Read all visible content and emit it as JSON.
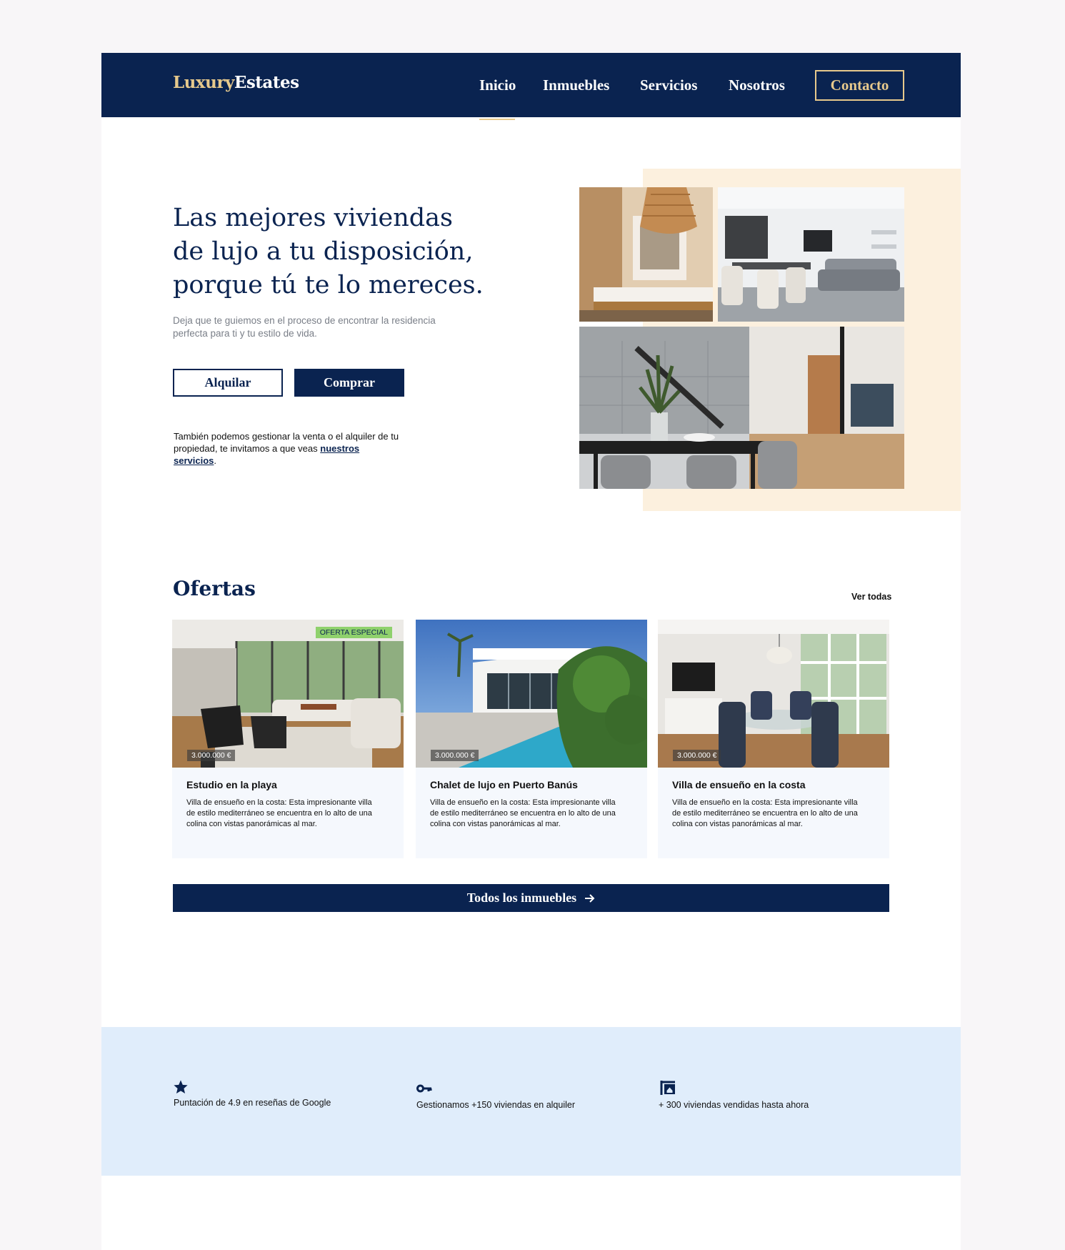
{
  "brand": {
    "part1": "Luxury",
    "part2": "Estates"
  },
  "nav": {
    "items": [
      "Inicio",
      "Inmuebles",
      "Servicios",
      "Nosotros"
    ],
    "contact": "Contacto"
  },
  "hero": {
    "title": "Las mejores viviendas de lujo a tu disposición, porque tú te lo mereces.",
    "subtitle": "Deja que te guiemos en el proceso de encontrar la residencia perfecta para ti y tu estilo de vida.",
    "rent_label": "Alquilar",
    "buy_label": "Comprar",
    "note_text": "También podemos gestionar la venta o el alquiler de tu propiedad, te invitamos a que veas ",
    "note_link": "nuestros servicios",
    "note_end": "."
  },
  "offers": {
    "title": "Ofertas",
    "see_all": "Ver todas",
    "cards": [
      {
        "title": "Estudio en la playa",
        "price": "3.000.000 €",
        "badge": "OFERTA ESPECIAL",
        "desc": "Villa de ensueño en la costa: Esta impresionante villa de estilo mediterráneo se encuentra en lo alto de una colina con vistas panorámicas al mar."
      },
      {
        "title": "Chalet de lujo en Puerto Banús",
        "price": "3.000.000 €",
        "badge": "",
        "desc": "Villa de ensueño en la costa: Esta impresionante villa de estilo mediterráneo se encuentra en lo alto de una colina con vistas panorámicas al mar."
      },
      {
        "title": "Villa de ensueño en la costa",
        "price": "3.000.000 €",
        "badge": "",
        "desc": "Villa de ensueño en la costa: Esta impresionante villa de estilo mediterráneo se encuentra en lo alto de una colina con vistas panorámicas al mar."
      }
    ],
    "all_button": "Todos los inmuebles"
  },
  "stats": [
    {
      "icon": "star-icon",
      "text": "Puntación de 4.9 en reseñas de Google"
    },
    {
      "icon": "key-icon",
      "text": "Gestionamos +150 viviendas en alquiler"
    },
    {
      "icon": "sale-sign-icon",
      "text": "+ 300 viviendas vendidas hasta ahora"
    }
  ],
  "colors": {
    "navy": "#0a2350",
    "gold": "#e7c98c",
    "cream": "#fcf0de",
    "light_blue": "#e0edfb",
    "badge_green": "#8fd16c"
  }
}
